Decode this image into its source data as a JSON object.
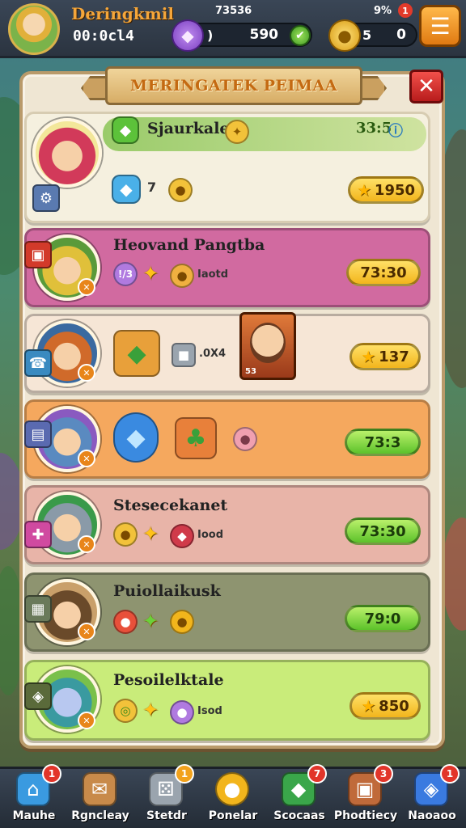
{
  "hud": {
    "player_name": "Deringkmil",
    "timer": "00:0cl4",
    "top_small_value": "73536",
    "top_pct": "9%",
    "alert_count": "1",
    "gems": {
      "left_value": ")",
      "right_value": "590",
      "icon": "gem-shield-icon"
    },
    "coins": {
      "left_value": "5",
      "right_value": "0",
      "icon": "coin-icon"
    },
    "menu_icon": "menu-icon"
  },
  "panel": {
    "title": "MERINGATEK PEIMAA",
    "close_label": "✕"
  },
  "rows": [
    {
      "title": "Sjaurkale",
      "header_value": "33:5",
      "count": "7",
      "reward": "1950",
      "reward_style": "yellow"
    },
    {
      "title": "Heovand Pangtba",
      "level_chip": "!/3",
      "small_text": "Iaotd",
      "reward": "73:30",
      "reward_style": "yellow"
    },
    {
      "title": "",
      "small_text": ".0X4",
      "card_label": "53",
      "reward": "137",
      "reward_style": "yellow"
    },
    {
      "title": "",
      "reward": "73:3",
      "reward_style": "green"
    },
    {
      "title": "Stesecekanet",
      "small_text": "Iood",
      "reward": "73:30",
      "reward_style": "green"
    },
    {
      "title": "Puiollaikusk",
      "reward": "79:0",
      "reward_style": "green"
    },
    {
      "title": "Pesoilelktale",
      "small_text": "Isod",
      "reward": "850",
      "reward_style": "yellow"
    }
  ],
  "nav": [
    {
      "label": "Mauhe",
      "badge": "1",
      "badge_color": "red",
      "icon": "home-icon",
      "color": "#3a9ae0"
    },
    {
      "label": "Rgncleay",
      "badge": "",
      "badge_color": "",
      "icon": "quest-scroll-icon",
      "color": "#c88a4a"
    },
    {
      "label": "Stetdr",
      "badge": "1",
      "badge_color": "orange",
      "icon": "dice-icon",
      "color": "#9aa4ae"
    },
    {
      "label": "Ponelar",
      "badge": "",
      "badge_color": "",
      "icon": "chat-bubble-icon",
      "color": "#f2b51c"
    },
    {
      "label": "Scocaas",
      "badge": "7",
      "badge_color": "red",
      "icon": "emerald-icon",
      "color": "#3aa64a"
    },
    {
      "label": "Phodtiecy",
      "badge": "3",
      "badge_color": "red",
      "icon": "chest-icon",
      "color": "#c06a3a"
    },
    {
      "label": "Naoaoo",
      "badge": "1",
      "badge_color": "red",
      "icon": "crystal-icon",
      "color": "#3a7ae0"
    }
  ]
}
